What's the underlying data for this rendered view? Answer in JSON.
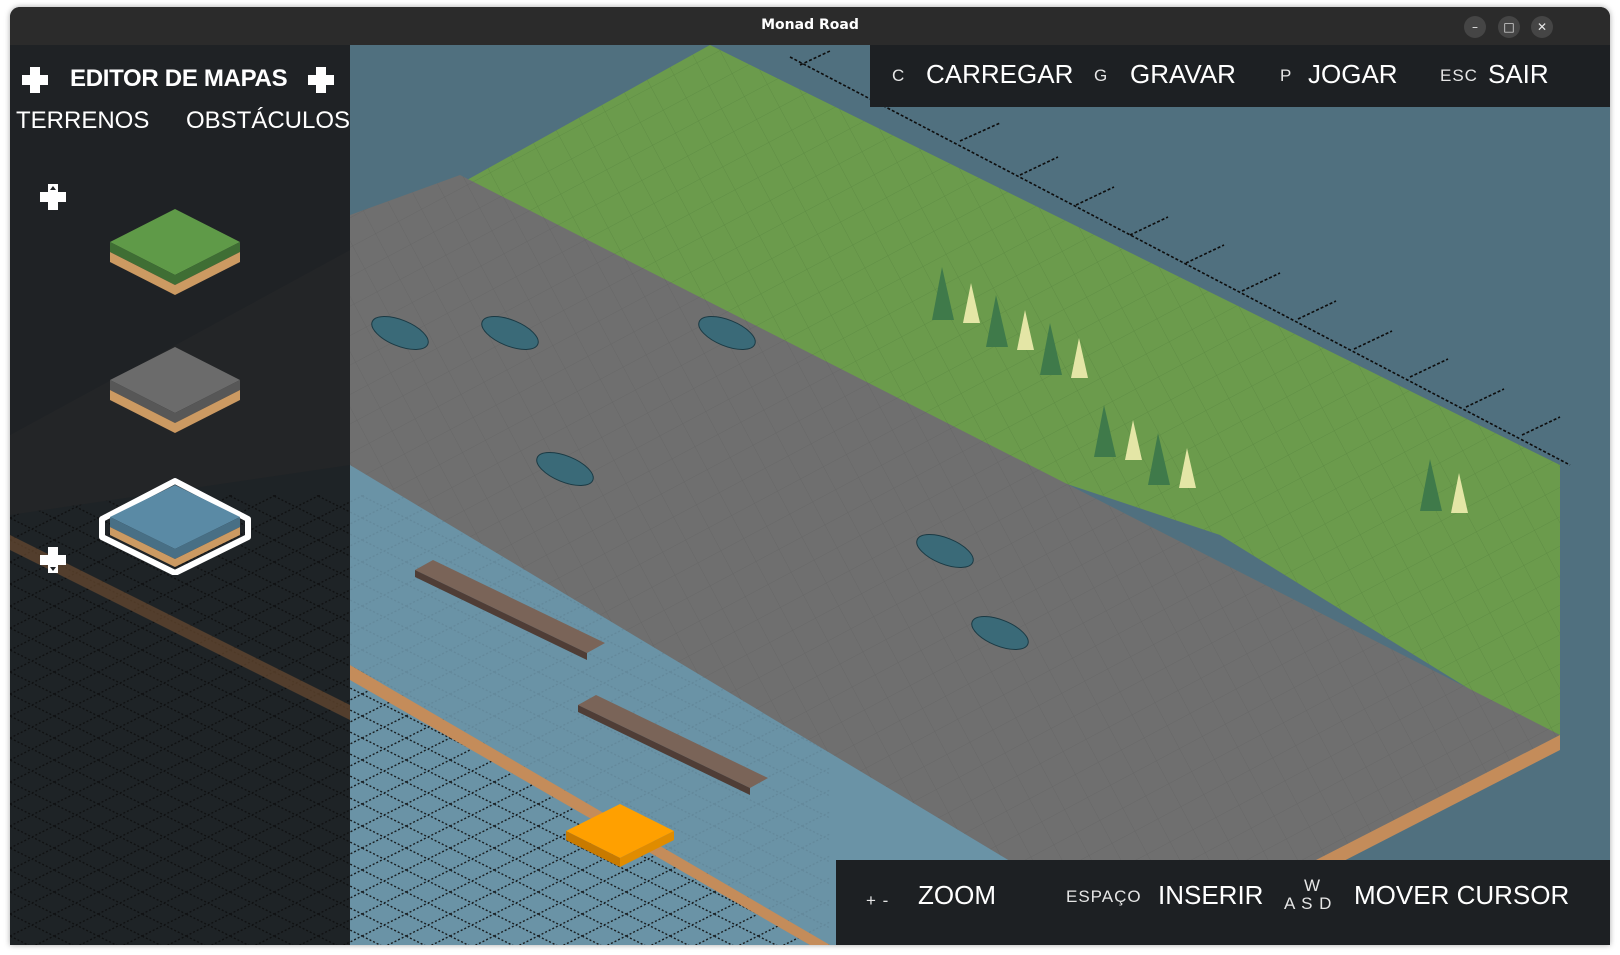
{
  "window": {
    "title": "Monad Road",
    "controls": {
      "minimize": "–",
      "maximize": "□",
      "close": "✕"
    }
  },
  "sidebar": {
    "title": "EDITOR DE MAPAS",
    "tabs": [
      {
        "label": "TERRENOS",
        "active": true
      },
      {
        "label": "OBSTÁCULOS",
        "active": false
      }
    ],
    "tiles": [
      {
        "name": "grass",
        "top_color": "#5f9a48",
        "side_color": "#cc9a62",
        "selected": false
      },
      {
        "name": "road",
        "top_color": "#6b6b6b",
        "side_color": "#cc9a62",
        "selected": false
      },
      {
        "name": "water",
        "top_color": "#5a8aa5",
        "side_color": "#cc9a62",
        "selected": true
      }
    ],
    "scroll_up_icon": "dpad-up-icon",
    "scroll_down_icon": "dpad-down-icon"
  },
  "top_menu": [
    {
      "key": "C",
      "label": "CARREGAR"
    },
    {
      "key": "G",
      "label": "GRAVAR"
    },
    {
      "key": "P",
      "label": "JOGAR"
    },
    {
      "key": "ESC",
      "label": "SAIR"
    }
  ],
  "bottom_menu": [
    {
      "key": "+ -",
      "label": "ZOOM"
    },
    {
      "key": "ESPAÇO",
      "label": "INSERIR"
    },
    {
      "key_top": "W",
      "key_bottom": "A S D",
      "label": "MOVER CURSOR"
    }
  ],
  "colors": {
    "grass": "#6b9b4c",
    "road": "#6f6f6f",
    "water": "#6a93a6",
    "deep_water": "#50707f",
    "cursor": "#ffa000",
    "car": "#3a6a78",
    "log": "#6d5a50",
    "tree_dark": "#3f7a4a",
    "tree_light": "#e4e6a6"
  }
}
